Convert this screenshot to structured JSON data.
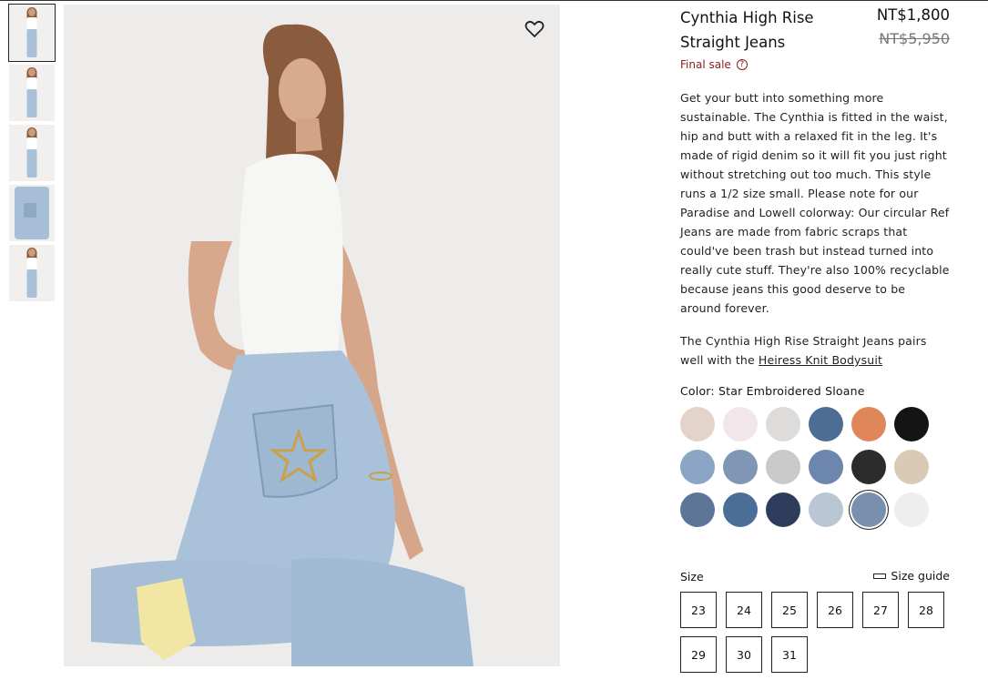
{
  "product": {
    "title": "Cynthia High Rise Straight Jeans",
    "price": "NT$1,800",
    "original_price": "NT$5,950",
    "final_sale": "Final sale",
    "help_icon": "?",
    "description": "Get your butt into something more sustainable. The Cynthia is fitted in the waist, hip and butt with a relaxed fit in the leg. It's made of rigid denim so it will fit you just right without stretching out too much. This style runs a 1/2 size small. Please note for our Paradise and Lowell colorway: Our circular Ref Jeans are made from fabric scraps that could've been trash but instead turned into really cute stuff. They're also 100% recyclable because jeans this good deserve to be around forever.",
    "pairs_prefix": "The Cynthia High Rise Straight Jeans pairs well with the ",
    "pairs_link": "Heiress Knit Bodysuit"
  },
  "color": {
    "label": "Color: Star Embroidered Sloane",
    "selected_index": 16,
    "swatches": [
      {
        "name": "beige-denim",
        "color": "#e3d3c8"
      },
      {
        "name": "star-embroidered-pink",
        "color": "#f1e6ea"
      },
      {
        "name": "light-grey",
        "color": "#dddcdb"
      },
      {
        "name": "dark-wash",
        "color": "#4e6d94"
      },
      {
        "name": "floral-orange",
        "color": "#e0875a"
      },
      {
        "name": "black",
        "color": "#141414"
      },
      {
        "name": "light-blue",
        "color": "#8aa6c4"
      },
      {
        "name": "blue-print",
        "color": "#7f97b4"
      },
      {
        "name": "bw-print",
        "color": "#c9c9c9"
      },
      {
        "name": "heart-embroidered",
        "color": "#6c86ad"
      },
      {
        "name": "washed-black",
        "color": "#2c2c2c"
      },
      {
        "name": "tan",
        "color": "#d8cab4"
      },
      {
        "name": "mid-wash",
        "color": "#5d7697"
      },
      {
        "name": "medium-blue",
        "color": "#4a6e96"
      },
      {
        "name": "indigo",
        "color": "#2f3d5c"
      },
      {
        "name": "pale-blue",
        "color": "#bac6d3"
      },
      {
        "name": "star-embroidered-sloane",
        "color": "#7890ad"
      },
      {
        "name": "white",
        "color": "#eeeeef"
      }
    ]
  },
  "sizes": {
    "label": "Size",
    "guide_label": "Size guide",
    "options": [
      "23",
      "24",
      "25",
      "26",
      "27",
      "28",
      "29",
      "30",
      "31"
    ]
  },
  "gallery": {
    "thumbnail_count": 5,
    "active_index": 0
  }
}
